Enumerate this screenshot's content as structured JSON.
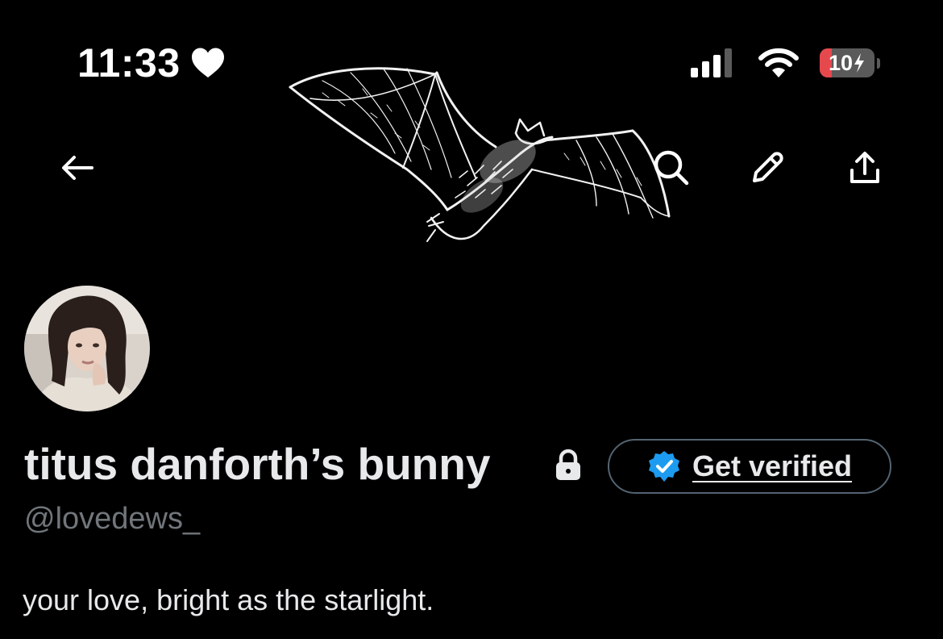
{
  "status_bar": {
    "time": "11:33",
    "battery_percent": "10",
    "battery_level": 0.1,
    "icons": [
      "heart-icon",
      "cellular-signal-icon",
      "wifi-icon",
      "battery-icon",
      "charging-bolt-icon"
    ]
  },
  "nav": {
    "icons": [
      "back-arrow-icon",
      "search-icon",
      "edit-pencil-icon",
      "share-icon"
    ]
  },
  "profile": {
    "display_name": "titus danforth’s bunny",
    "handle": "@lovedews_",
    "bio": "your love, bright as the starlight.",
    "protected": true,
    "protected_icon": "lock-icon",
    "verify_button_label": "Get verified",
    "verify_icon": "verified-badge-icon",
    "header_image": "bat-illustration",
    "avatar_image": "avatar-photo"
  },
  "colors": {
    "background": "#000000",
    "text_primary": "#e7e9ea",
    "text_secondary": "#71767b",
    "verified_blue": "#1d9bf0",
    "battery_low_red": "#e5484d",
    "button_border": "#536471"
  }
}
